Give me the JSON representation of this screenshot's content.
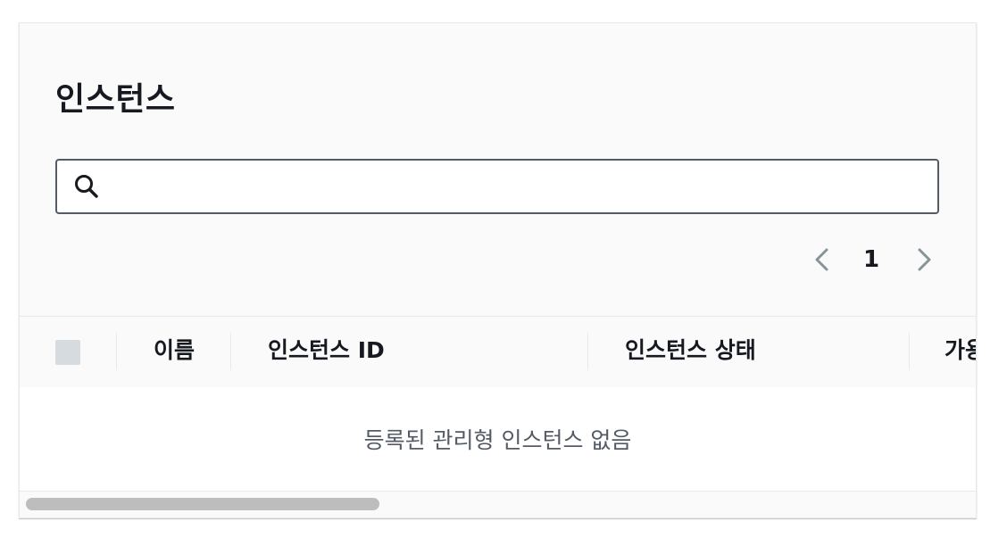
{
  "panel": {
    "title": "인스턴스"
  },
  "search": {
    "placeholder": "",
    "value": "",
    "icon": "search-icon"
  },
  "pagination": {
    "current_page": "1",
    "prev_icon": "chevron-left-icon",
    "next_icon": "chevron-right-icon"
  },
  "table": {
    "columns": [
      {
        "label": "이름"
      },
      {
        "label": "인스턴스 ID"
      },
      {
        "label": "인스턴스 상태"
      },
      {
        "label": "가용"
      }
    ],
    "empty_message": "등록된 관리형 인스턴스 없음"
  },
  "colors": {
    "text_primary": "#16191f",
    "text_secondary": "#545b64",
    "border": "#e6e9ee",
    "panel_bg": "#fafafa",
    "checkbox_bg": "#d6dbdf",
    "scroll_thumb": "#bdbdbd"
  }
}
